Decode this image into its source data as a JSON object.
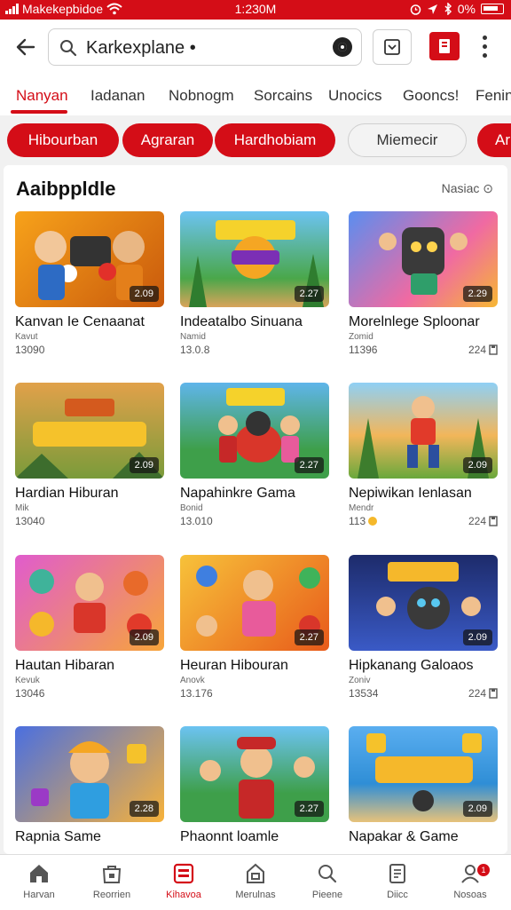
{
  "status_bar": {
    "carrier": "Makekepbidoe",
    "time": "1:230M",
    "battery": "0%"
  },
  "search": {
    "query": "Karkexplane •"
  },
  "tabs": [
    "Nanyan",
    "Iadanan",
    "Nobnogm",
    "Sorcains",
    "Unocics",
    "Gooncs!",
    "Fenin"
  ],
  "chips": [
    "Hibourban",
    "Agraran",
    "Hardhobiam",
    "Miemecir",
    "Ar"
  ],
  "section": {
    "title": "Aaibppldle",
    "more": "Nasiac ⊙"
  },
  "cards": [
    {
      "title": "Kanvan Ie Cenaanat",
      "sub": "Kavut",
      "meta": "13090",
      "badge": "2.09",
      "right": ""
    },
    {
      "title": "Indeatalbo Sinuana",
      "sub": "Namid",
      "meta": "13.0.8",
      "badge": "2.27",
      "right": ""
    },
    {
      "title": "Morelnlege Sploonar",
      "sub": "Zomid",
      "meta": "11396",
      "badge": "2.29",
      "right": "224"
    },
    {
      "title": "Hardian Hiburan",
      "sub": "Mik",
      "meta": "13040",
      "badge": "2.09",
      "right": ""
    },
    {
      "title": "Napahinkre Gama",
      "sub": "Bonid",
      "meta": "13.010",
      "badge": "2.27",
      "right": ""
    },
    {
      "title": "Nepiwikan Ienlasan",
      "sub": "Mendr",
      "meta": "113",
      "badge": "2.09",
      "right": "224"
    },
    {
      "title": "Hautan Hibaran",
      "sub": "Kevuk",
      "meta": "13046",
      "badge": "2.09",
      "right": ""
    },
    {
      "title": "Heuran Hibouran",
      "sub": "Anovk",
      "meta": "13.176",
      "badge": "2.27",
      "right": ""
    },
    {
      "title": "Hipkanang Galoaos",
      "sub": "Zoniv",
      "meta": "13534",
      "badge": "2.09",
      "right": "224"
    },
    {
      "title": "Rapnia Same",
      "sub": "",
      "meta": "",
      "badge": "2.28",
      "right": ""
    },
    {
      "title": "Phaonnt loamle",
      "sub": "",
      "meta": "",
      "badge": "2.27",
      "right": ""
    },
    {
      "title": "Napakar & Game",
      "sub": "",
      "meta": "",
      "badge": "2.09",
      "right": ""
    }
  ],
  "bottom_nav": [
    "Harvan",
    "Reorrien",
    "Kihavoa",
    "Merulnas",
    "Pieene",
    "Diicc",
    "Nosoas"
  ],
  "notification_count": "1",
  "colors": {
    "accent": "#d40d17"
  }
}
